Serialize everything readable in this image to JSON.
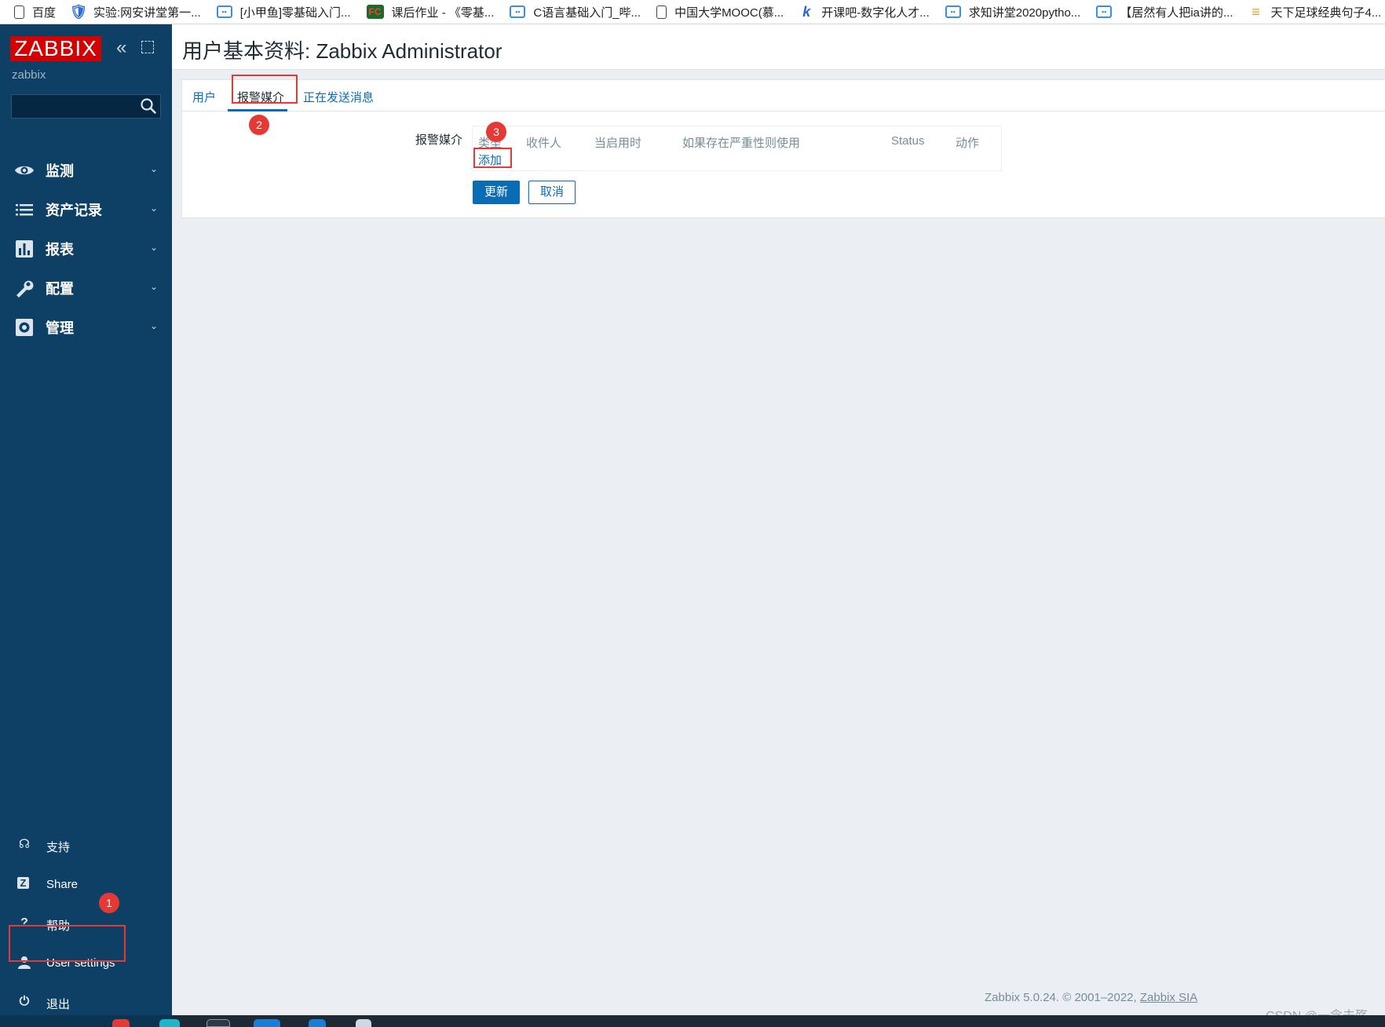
{
  "browser": {
    "bookmarks": [
      {
        "icon": "doc-icon",
        "label": "百度"
      },
      {
        "icon": "shield-icon",
        "label": "实验:网安讲堂第一..."
      },
      {
        "icon": "bilibili-icon",
        "label": "[小甲鱼]零基础入门..."
      },
      {
        "icon": "fc-icon",
        "label": "课后作业 - 《零基..."
      },
      {
        "icon": "bilibili-icon",
        "label": "C语言基础入门_哔..."
      },
      {
        "icon": "doc-icon",
        "label": "中国大学MOOC(慕..."
      },
      {
        "icon": "k-icon",
        "label": "开课吧-数字化人才..."
      },
      {
        "icon": "bilibili-icon",
        "label": "求知讲堂2020pytho..."
      },
      {
        "icon": "bilibili-icon",
        "label": "【居然有人把ia讲的..."
      },
      {
        "icon": "z-icon",
        "label": "天下足球经典句子4..."
      }
    ]
  },
  "sidebar": {
    "logo": "ZABBIX",
    "server_name": "zabbix",
    "search_placeholder": "",
    "menu": [
      {
        "icon": "eye-icon",
        "label": "监测"
      },
      {
        "icon": "list-icon",
        "label": "资产记录"
      },
      {
        "icon": "bar-chart-icon",
        "label": "报表"
      },
      {
        "icon": "wrench-icon",
        "label": "配置"
      },
      {
        "icon": "gear-icon",
        "label": "管理"
      }
    ],
    "bottom": [
      {
        "icon": "headset-icon",
        "label": "支持"
      },
      {
        "icon": "share-icon",
        "label": "Share"
      },
      {
        "icon": "help-icon",
        "label": "帮助"
      },
      {
        "icon": "user-icon",
        "label": "User settings"
      },
      {
        "icon": "power-icon",
        "label": "退出"
      }
    ]
  },
  "page": {
    "title": "用户基本资料: Zabbix Administrator",
    "tabs": [
      "用户",
      "报警媒介",
      "正在发送消息"
    ],
    "form_label": "报警媒介",
    "table_headers": [
      "类型",
      "收件人",
      "当启用时",
      "如果存在严重性则使用",
      "Status",
      "动作"
    ],
    "add_link": "添加",
    "update_button": "更新",
    "cancel_button": "取消"
  },
  "annotations": {
    "step1": "1",
    "step2": "2",
    "step3": "3"
  },
  "footer": {
    "text": "Zabbix 5.0.24. © 2001–2022, ",
    "link": "Zabbix SIA"
  },
  "watermark": "CSDN @一念去殇",
  "colors": {
    "sidebar_bg": "#0e4066",
    "logo_red": "#d40000",
    "accent_blue": "#0a6cb5",
    "annotation_red": "#e53935"
  }
}
